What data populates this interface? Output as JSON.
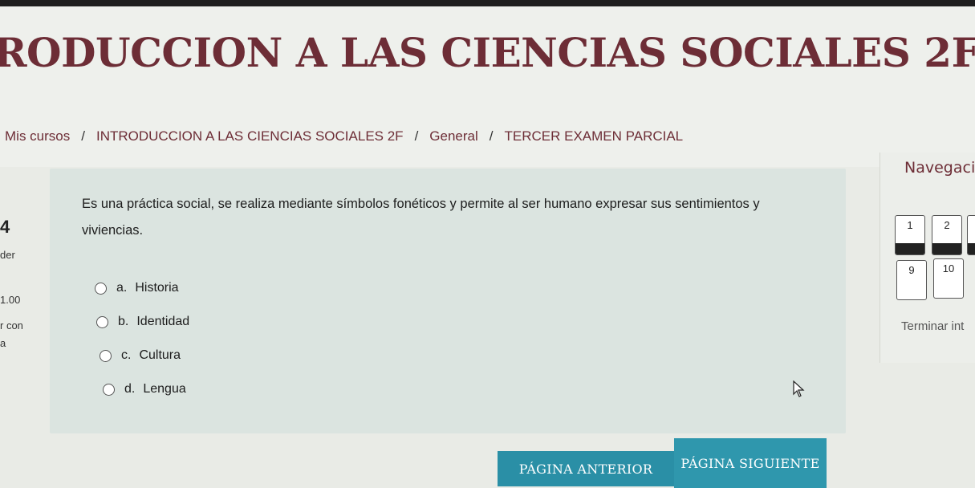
{
  "header": {
    "course_title": "RODUCCION A LAS CIENCIAS SOCIALES 2F",
    "breadcrumb": [
      "Mis cursos",
      "INTRODUCCION A LAS CIENCIAS SOCIALES 2F",
      "General",
      "TERCER EXAMEN PARCIAL"
    ],
    "separator": "/"
  },
  "question_info": {
    "number": "4",
    "status": "der",
    "grade": "1.00",
    "flag_line1": "r con",
    "flag_line2": "a"
  },
  "question": {
    "text": "Es una práctica social, se realiza mediante  símbolos fonéticos y permite al ser humano expresar sus sentimientos y viviencias.",
    "options": [
      {
        "letter": "a.",
        "label": "Historia"
      },
      {
        "letter": "b.",
        "label": "Identidad"
      },
      {
        "letter": "c.",
        "label": "Cultura"
      },
      {
        "letter": "d.",
        "label": "Lengua"
      }
    ]
  },
  "buttons": {
    "previous": "PÁGINA ANTERIOR",
    "next": "PÁGINA SIGUIENTE"
  },
  "navigation": {
    "title": "Navegació",
    "questions": [
      {
        "label": "1",
        "answered": true
      },
      {
        "label": "2",
        "answered": true
      },
      {
        "label": "",
        "answered": true
      },
      {
        "label": "9",
        "answered": false
      },
      {
        "label": "10",
        "answered": false
      }
    ],
    "finish_link": "Terminar int"
  },
  "colors": {
    "brand": "#6d2d36",
    "button": "#2a8fa6",
    "card": "#dbe4e0"
  }
}
